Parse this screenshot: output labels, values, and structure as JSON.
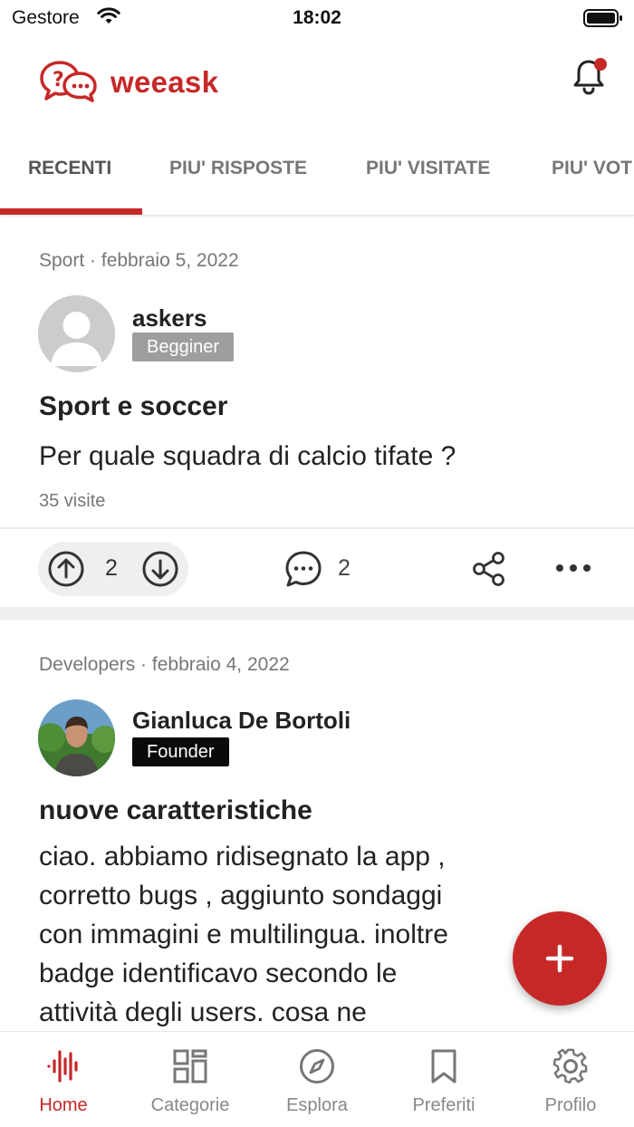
{
  "status_bar": {
    "carrier": "Gestore",
    "time": "18:02"
  },
  "header": {
    "brand": "weeask",
    "logo_text": "?..."
  },
  "tabs": [
    {
      "label": "RECENTI",
      "active": true
    },
    {
      "label": "PIU' RISPOSTE",
      "active": false
    },
    {
      "label": "PIU' VISITATE",
      "active": false
    },
    {
      "label": "PIU' VOT",
      "active": false
    }
  ],
  "posts": [
    {
      "meta": "Sport · febbraio 5, 2022",
      "author": "askers",
      "badge": "Begginer",
      "title": "Sport e soccer",
      "body": "Per quale squadra di calcio tifate ?",
      "views": "35 visite",
      "votes": "2",
      "comments": "2"
    },
    {
      "meta": "Developers · febbraio 4, 2022",
      "author": "Gianluca De Bortoli",
      "badge": "Founder",
      "title": "nuove caratteristiche",
      "body_lines": [
        "ciao. abbiamo ridisegnato la app ,",
        "corretto bugs , aggiunto sondaggi",
        "con immagini e multilingua.  inoltre",
        "badge identificavo secondo  le",
        "attività degli users.  cosa ne"
      ]
    }
  ],
  "bottom_nav": [
    {
      "label": "Home",
      "icon": "home-wave-icon",
      "active": true
    },
    {
      "label": "Categorie",
      "icon": "categories-grid-icon",
      "active": false
    },
    {
      "label": "Esplora",
      "icon": "compass-icon",
      "active": false
    },
    {
      "label": "Preferiti",
      "icon": "bookmark-icon",
      "active": false
    },
    {
      "label": "Profilo",
      "icon": "gear-icon",
      "active": false
    }
  ],
  "colors": {
    "accent": "#c62828",
    "text": "#222222",
    "muted": "#777777"
  }
}
